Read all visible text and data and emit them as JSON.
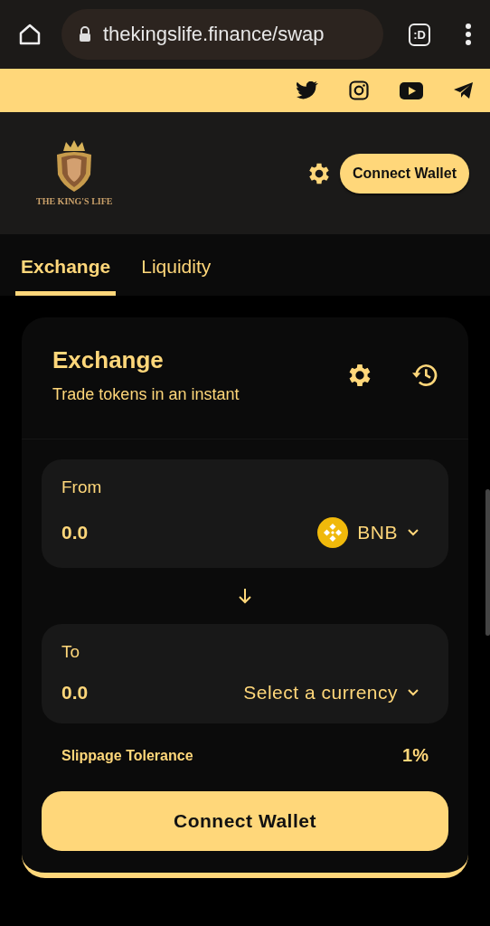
{
  "browser": {
    "url": "thekingslife.finance/swap",
    "tab_switcher": ":D"
  },
  "header": {
    "logo_text": "THE KING'S LIFE",
    "connect_button": "Connect Wallet"
  },
  "tabs": [
    {
      "label": "Exchange",
      "selected": true
    },
    {
      "label": "Liquidity",
      "selected": false
    }
  ],
  "card": {
    "title": "Exchange",
    "subtitle": "Trade tokens in an instant",
    "from": {
      "label": "From",
      "placeholder": "0.0",
      "token": "BNB",
      "token_icon": true
    },
    "to": {
      "label": "To",
      "placeholder": "0.0",
      "token": "Select a currency",
      "token_icon": false
    },
    "slippage": {
      "label": "Slippage Tolerance",
      "value": "1%"
    },
    "button": "Connect Wallet"
  }
}
